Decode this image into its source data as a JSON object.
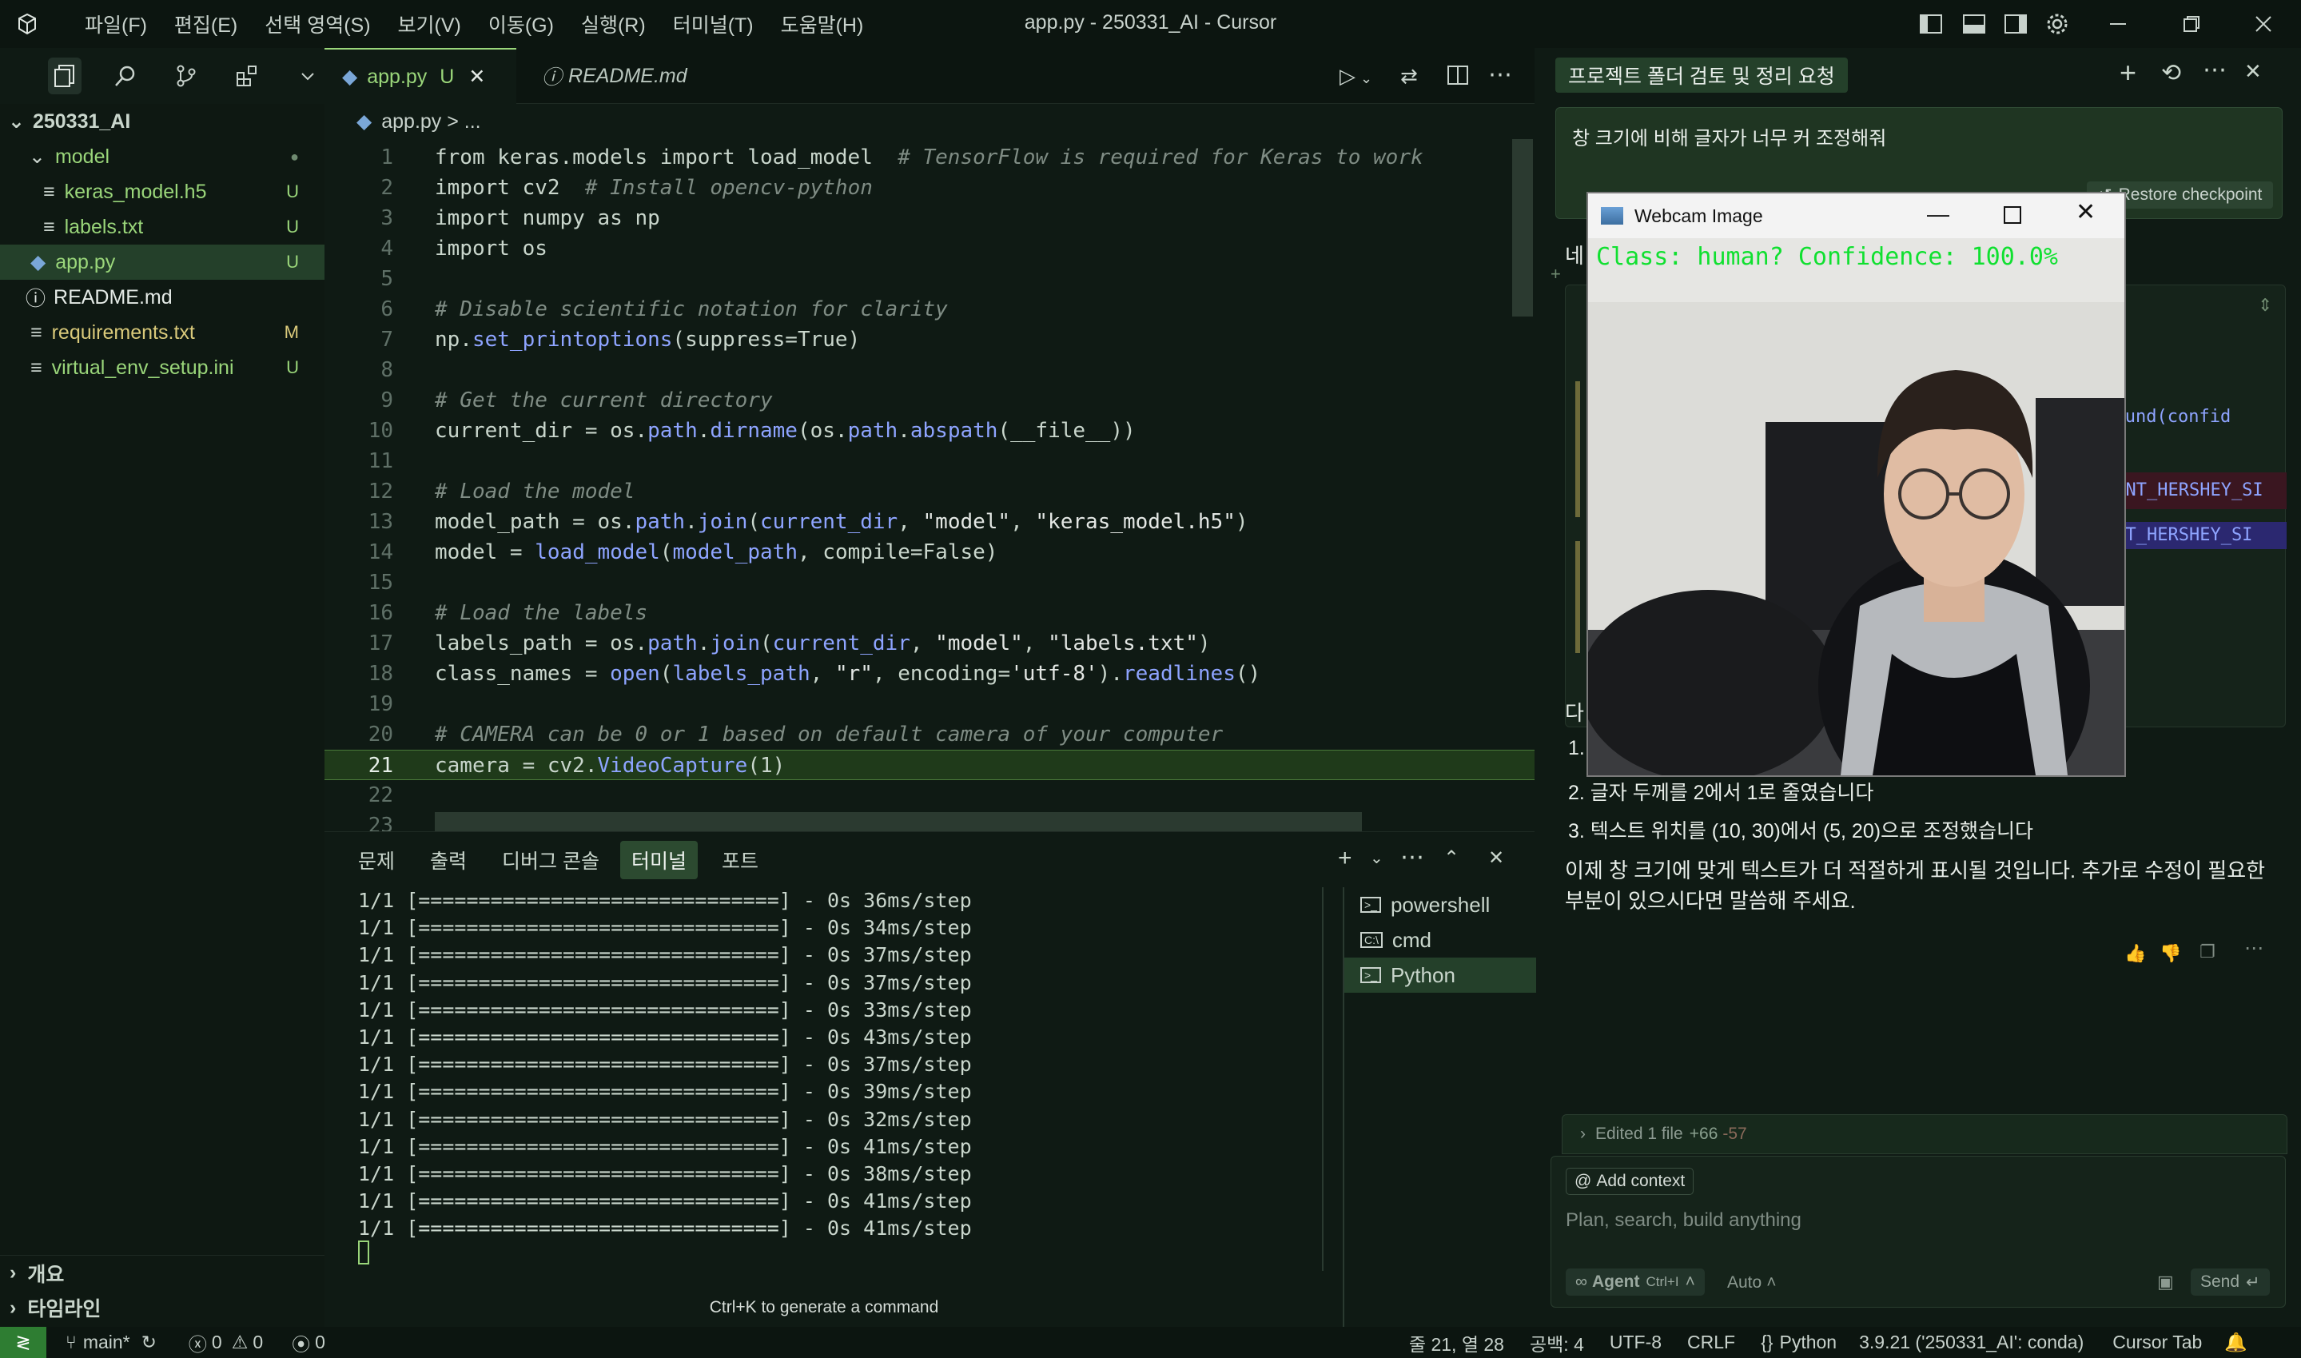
{
  "window": {
    "title": "app.py - 250331_AI - Cursor",
    "menu": [
      "파일(F)",
      "편집(E)",
      "선택 영역(S)",
      "보기(V)",
      "이동(G)",
      "실행(R)",
      "터미널(T)",
      "도움말(H)"
    ]
  },
  "explorer": {
    "root": "250331_AI",
    "items": [
      {
        "label": "model",
        "badge": "●"
      },
      {
        "label": "keras_model.h5",
        "badge": "U"
      },
      {
        "label": "labels.txt",
        "badge": "U"
      },
      {
        "label": "app.py",
        "badge": "U"
      },
      {
        "label": "README.md",
        "badge": ""
      },
      {
        "label": "requirements.txt",
        "badge": "M"
      },
      {
        "label": "virtual_env_setup.ini",
        "badge": "U"
      }
    ],
    "outline": "개요",
    "timeline": "타임라인"
  },
  "editor": {
    "tabs": [
      {
        "label": "app.py",
        "badge": "U"
      },
      {
        "label": "README.md"
      }
    ],
    "breadcrumb": "app.py > ...",
    "lines": [
      {
        "n": "1",
        "code": "from keras.models import load_model  # TensorFlow is required for Keras to work"
      },
      {
        "n": "2",
        "code": "import cv2  # Install opencv-python"
      },
      {
        "n": "3",
        "code": "import numpy as np"
      },
      {
        "n": "4",
        "code": "import os"
      },
      {
        "n": "5",
        "code": ""
      },
      {
        "n": "6",
        "code": "# Disable scientific notation for clarity"
      },
      {
        "n": "7",
        "code": "np.set_printoptions(suppress=True)"
      },
      {
        "n": "8",
        "code": ""
      },
      {
        "n": "9",
        "code": "# Get the current directory"
      },
      {
        "n": "10",
        "code": "current_dir = os.path.dirname(os.path.abspath(__file__))"
      },
      {
        "n": "11",
        "code": ""
      },
      {
        "n": "12",
        "code": "# Load the model"
      },
      {
        "n": "13",
        "code": "model_path = os.path.join(current_dir, \"model\", \"keras_model.h5\")"
      },
      {
        "n": "14",
        "code": "model = load_model(model_path, compile=False)"
      },
      {
        "n": "15",
        "code": ""
      },
      {
        "n": "16",
        "code": "# Load the labels"
      },
      {
        "n": "17",
        "code": "labels_path = os.path.join(current_dir, \"model\", \"labels.txt\")"
      },
      {
        "n": "18",
        "code": "class_names = open(labels_path, \"r\", encoding='utf-8').readlines()"
      },
      {
        "n": "19",
        "code": ""
      },
      {
        "n": "20",
        "code": "# CAMERA can be 0 or 1 based on default camera of your computer"
      },
      {
        "n": "21",
        "code": "camera = cv2.VideoCapture(1)"
      },
      {
        "n": "22",
        "code": ""
      },
      {
        "n": "23",
        "code": ""
      }
    ]
  },
  "panel": {
    "tabs": [
      "문제",
      "출력",
      "디버그 콘솔",
      "터미널",
      "포트"
    ],
    "active_tab": "터미널",
    "terminal_lines": [
      "1/1 [==============================] - 0s 36ms/step",
      "1/1 [==============================] - 0s 34ms/step",
      "1/1 [==============================] - 0s 37ms/step",
      "1/1 [==============================] - 0s 37ms/step",
      "1/1 [==============================] - 0s 33ms/step",
      "1/1 [==============================] - 0s 43ms/step",
      "1/1 [==============================] - 0s 37ms/step",
      "1/1 [==============================] - 0s 39ms/step",
      "1/1 [==============================] - 0s 32ms/step",
      "1/1 [==============================] - 0s 41ms/step",
      "1/1 [==============================] - 0s 38ms/step",
      "1/1 [==============================] - 0s 41ms/step",
      "1/1 [==============================] - 0s 41ms/step"
    ],
    "hint": "Ctrl+K to generate a command",
    "terminals": [
      "powershell",
      "cmd",
      "Python"
    ]
  },
  "chat": {
    "title": "프로젝트 폴더 검토 및 정리 요청",
    "user_message": "창 크기에 비해 글자가 너무 커 조정해줘",
    "restore": "Restore checkpoint",
    "reply_prefix": "네",
    "code_snips": [
      ".round(confid",
      "FONT_HERSHEY_SI",
      "ONT_HERSHEY_SI"
    ],
    "list_prefix": "다",
    "item1": "1.",
    "item2": "2. 글자 두께를 2에서 1로 줄였습니다",
    "item3": "3. 텍스트 위치를 (10, 30)에서 (5, 20)으로 조정했습니다",
    "conclusion": "이제 창 크기에 맞게 텍스트가 더 적절하게 표시될 것입니다. 추가로 수정이 필요한 부분이 있으시다면 말씀해 주세요.",
    "edited": "Edited 1 file",
    "added": "+66",
    "removed": "-57",
    "add_context": "Add context",
    "placeholder": "Plan, search, build anything",
    "agent": "Agent",
    "agent_shortcut": "Ctrl+I",
    "auto": "Auto",
    "send": "Send"
  },
  "webcam": {
    "title": "Webcam Image",
    "overlay": "Class: human? Confidence: 100.0%"
  },
  "status": {
    "branch": "main*",
    "errors": "0",
    "warnings": "0",
    "ports": "0",
    "position": "줄 21, 열 28",
    "spaces": "공백: 4",
    "encoding": "UTF-8",
    "eol": "CRLF",
    "language": "Python",
    "interpreter": "3.9.21 ('250331_AI': conda)",
    "cursor_tab": "Cursor Tab"
  },
  "colors": {
    "accent": "#9ad67a",
    "bg": "#0f1a14",
    "active_line": "#1f3a1a"
  }
}
